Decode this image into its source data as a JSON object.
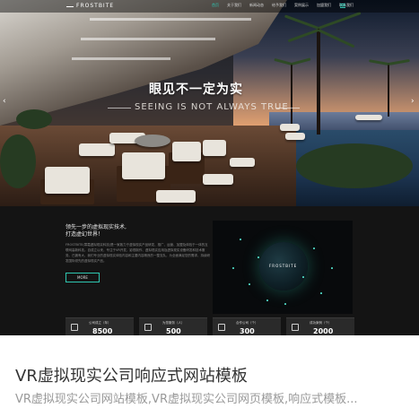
{
  "card": {
    "title": "VR虚拟现实公司响应式网站模板",
    "subtitle": "VR虚拟现实公司网站模板,VR虚拟现实公司网页模板,响应式模板..."
  },
  "preview": {
    "logo": "FROSTBITE",
    "nav_items": [
      "首页",
      "关于我们",
      "新闻动态",
      "给予我们",
      "案例展示",
      "加盟我们",
      "联系我们"
    ],
    "hero_title": "眼见不一定为实",
    "hero_subtitle": "SEEING IS NOT ALWAYS TRUE",
    "section_title": "领先一步的虚拟现实技术,\n打造虚幻世界！",
    "section_body": "FROSTBITE(寒霜虚拟现实科技)是一家致力于虚拟现实产品研发、推广、运营、加盟及体验于一体的互联网高新科技。自成立以来，专注于VR开发、影视制作、虚拟现实应用及虚拟现实设备研发和技术服务。已拥有大、我们专业的虚拟现实体验内容和主要内容精良的一整支队，为全面满足您的需求，持续研发国际领先的虚拟现实产品。",
    "more_label": "MORE",
    "globe_label": "FROSTBITE",
    "stats": [
      {
        "label": "公司成立（年）",
        "value": "8500"
      },
      {
        "label": "为您服务（人）",
        "value": "500"
      },
      {
        "label": "合作公司（个）",
        "value": "300"
      },
      {
        "label": "成功案例（个）",
        "value": "2000"
      }
    ]
  },
  "colors": {
    "accent": "#2ec5b0",
    "title_text": "#333333",
    "subtitle_text": "#999999"
  }
}
